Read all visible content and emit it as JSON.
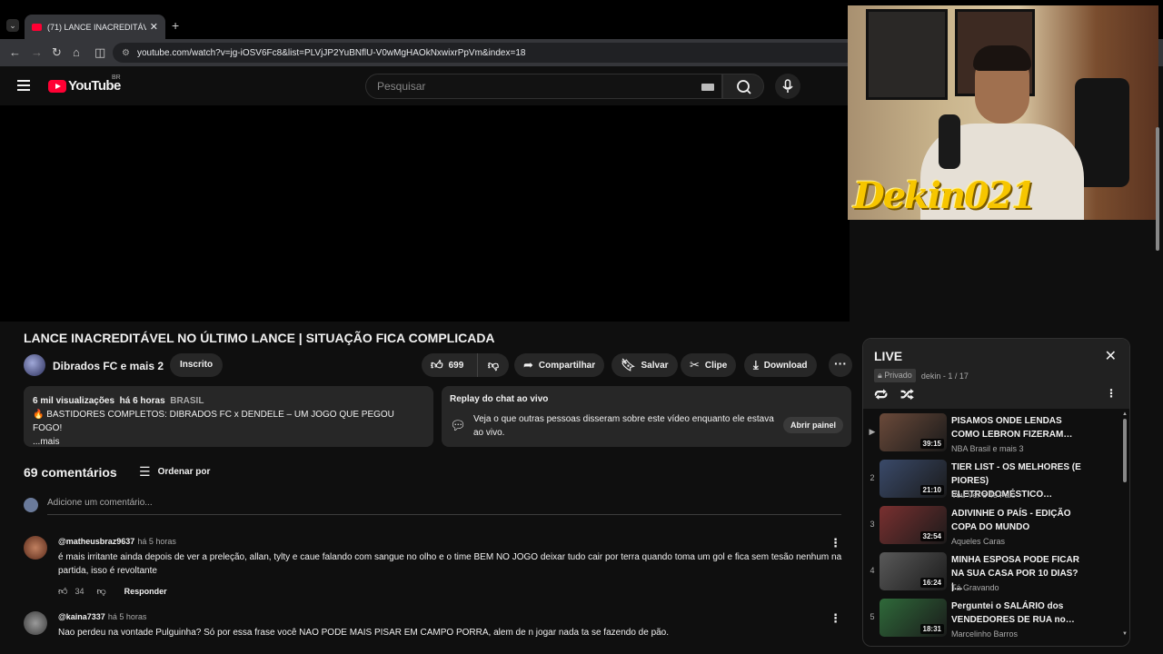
{
  "browser": {
    "tab_title": "(71) LANCE INACREDITÁVEL NO",
    "url": "youtube.com/watch?v=jg-iOSV6Fc8&list=PLVjJP2YuBNflU-V0wMgHAOkNxwixrPpVm&index=18"
  },
  "header": {
    "logo_text": "YouTube",
    "country_code": "BR",
    "search_placeholder": "Pesquisar"
  },
  "webcam": {
    "overlay_text": "Dekin021"
  },
  "video": {
    "title": "LANCE INACREDITÁVEL NO ÚLTIMO LANCE | SITUAÇÃO FICA COMPLICADA",
    "channel": "Dibrados FC e mais 2",
    "subscribe_label": "Inscrito",
    "likes": "699",
    "share_label": "Compartilhar",
    "save_label": "Salvar",
    "clip_label": "Clipe",
    "download_label": "Download"
  },
  "description": {
    "views": "6 mil visualizações",
    "age": "há 6 horas",
    "country": "BRASIL",
    "line1": "🔥 BASTIDORES COMPLETOS: DIBRADOS FC x DENDELE – UM JOGO QUE PEGOU FOGO!",
    "more": "...mais"
  },
  "chat_replay": {
    "heading": "Replay do chat ao vivo",
    "body": "Veja o que outras pessoas disseram sobre este vídeo enquanto ele estava ao vivo.",
    "button": "Abrir painel"
  },
  "comments": {
    "count_label": "69 comentários",
    "sort_label": "Ordenar por",
    "add_placeholder": "Adicione um comentário...",
    "reply_label": "Responder",
    "items": [
      {
        "author": "@matheusbraz9637",
        "time": "há 5 horas",
        "text": "é mais irritante ainda depois de ver a preleção, allan, tylty e caue falando com sangue no olho e o time BEM NO JOGO deixar tudo cair por terra quando toma um gol e fica sem tesão nenhum na partida, isso é revoltante",
        "likes": "34"
      },
      {
        "author": "@kaina7337",
        "time": "há 5 horas",
        "text": "Nao perdeu na vontade Pulguinha? Só por essa frase você NAO PODE MAIS PISAR EM CAMPO PORRA, alem de n jogar nada ta se fazendo de pão.",
        "likes": ""
      }
    ]
  },
  "playlist": {
    "title": "LIVE",
    "privacy": "Privado",
    "owner_position": "dekin - 1 / 17",
    "items": [
      {
        "index": "▶",
        "title": "PISAMOS ONDE LENDAS COMO LEBRON FIZERAM…",
        "channel": "NBA Brasil e mais 3",
        "duration": "39:15",
        "color": "#6b4a3a"
      },
      {
        "index": "2",
        "title": "TIER LIST - OS MELHORES (E PIORES) ELETRODOMÉSTICO…",
        "channel": "Vou Ver e Te Falo",
        "duration": "21:10",
        "color": "#3a4a6a"
      },
      {
        "index": "3",
        "title": "ADIVINHE O PAÍS - EDIÇÃO COPA DO MUNDO",
        "channel": "Aqueles Caras",
        "duration": "32:54",
        "color": "#7a3030"
      },
      {
        "index": "4",
        "title": "MINHA ESPOSA PODE FICAR NA SUA CASA POR 10 DIAS? |…",
        "channel": "Tá Gravando",
        "duration": "16:24",
        "color": "#5a5a5a"
      },
      {
        "index": "5",
        "title": "Perguntei o SALÁRIO dos VENDEDORES DE RUA no…",
        "channel": "Marcelinho Barros",
        "duration": "18:31",
        "color": "#2f6a3a"
      }
    ]
  }
}
